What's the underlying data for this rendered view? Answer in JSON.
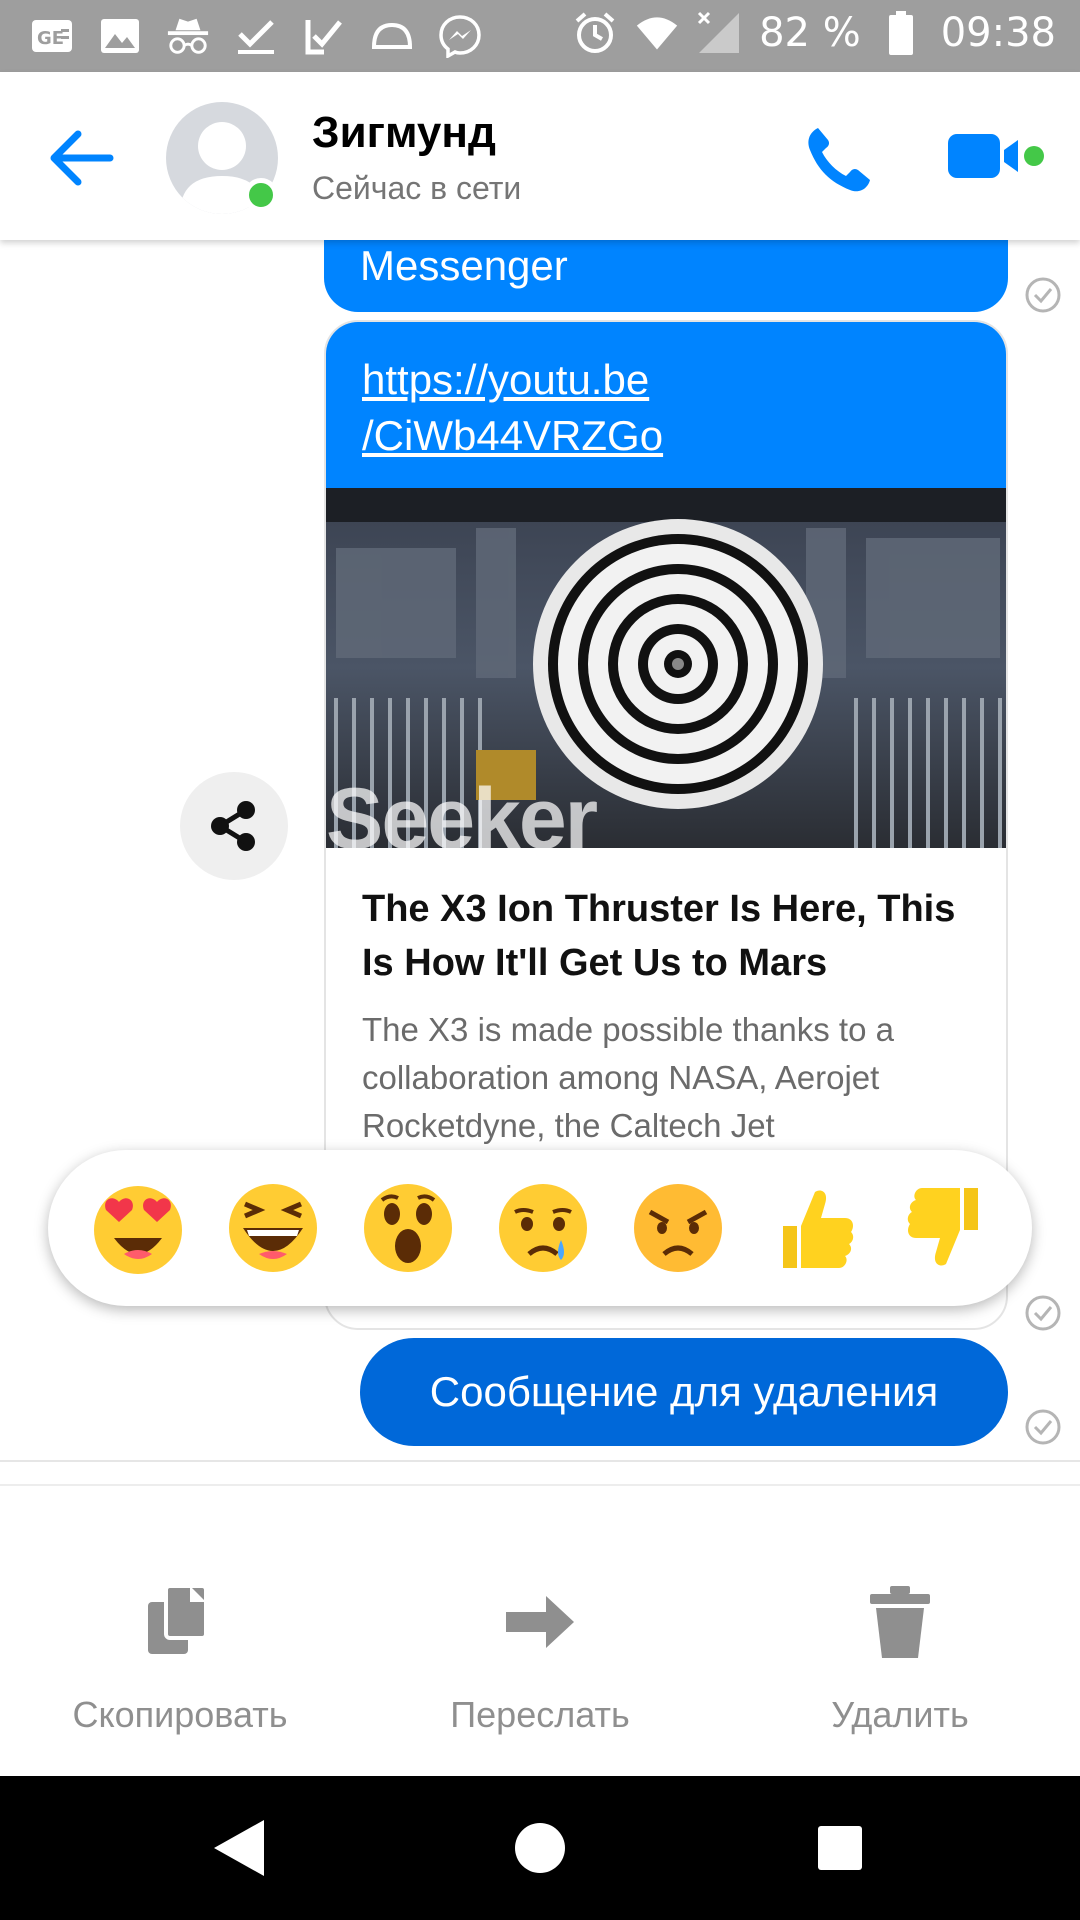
{
  "status_bar": {
    "battery": "82 %",
    "time": "09:38",
    "icons": [
      "news-icon",
      "image-icon",
      "incognito-icon",
      "check-icon",
      "double-check-icon",
      "cloud-icon",
      "messenger-icon",
      "alarm-icon",
      "wifi-icon",
      "no-signal-icon",
      "battery-icon"
    ]
  },
  "header": {
    "contact_name": "Зигмунд",
    "contact_status": "Сейчас в сети",
    "accent": "#0084ff",
    "online_color": "#44c848"
  },
  "messages": {
    "partial_text": "Messenger",
    "link_url": "https://youtu.be/CiWb44VRZGo",
    "link_url_line1": "https://youtu.be",
    "link_url_line2": "/CiWb44VRZGo",
    "thumbnail_watermark": "Seeker",
    "card_title": "The X3 Ion Thruster Is Here, This Is How It'll Get Us to Mars",
    "card_description": "The X3 is made possible thanks to a collaboration among NASA, Aerojet Rocketdyne, the Caltech Jet",
    "selected_message": "Сообщение для удаления"
  },
  "reactions": [
    "heart-eyes",
    "laughing",
    "wow",
    "sad",
    "angry",
    "thumbs-up",
    "thumbs-down"
  ],
  "actions": {
    "copy": "Скопировать",
    "forward": "Переслать",
    "delete": "Удалить"
  },
  "nav": [
    "back-icon",
    "home-icon",
    "recents-icon"
  ]
}
